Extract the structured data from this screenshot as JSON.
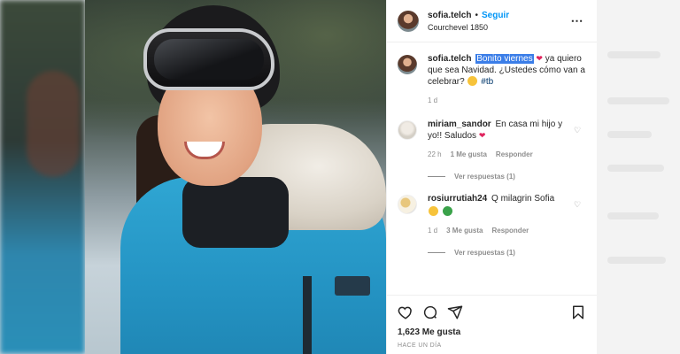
{
  "post": {
    "username": "sofia.telch",
    "separator": "•",
    "follow_label": "Seguir",
    "location": "Courchevel 1850",
    "more_icon": "more-options-icon"
  },
  "caption": {
    "username": "sofia.telch",
    "highlighted": "Bonito viernes",
    "text_1": "ya quiero que sea Navidad. ¿Ustedes cómo van a celebrar?",
    "hashtag": "#tb",
    "time": "1 d"
  },
  "comments": [
    {
      "username": "miriam_sandor",
      "text": "En casa mi hijo y yo!! Saludos",
      "time": "22 h",
      "likes": "1 Me gusta",
      "reply_label": "Responder",
      "view_replies": "Ver respuestas (1)"
    },
    {
      "username": "rosiurrutiah24",
      "text": "Q milagrin Sofia",
      "time": "1 d",
      "likes": "3 Me gusta",
      "reply_label": "Responder",
      "view_replies": "Ver respuestas (1)"
    }
  ],
  "footer": {
    "likes": "1,623 Me gusta",
    "posted": "HACE UN DÍA"
  },
  "colors": {
    "accent": "#0095f6",
    "highlight": "#3b7ee8",
    "heart": "#e0245e"
  }
}
